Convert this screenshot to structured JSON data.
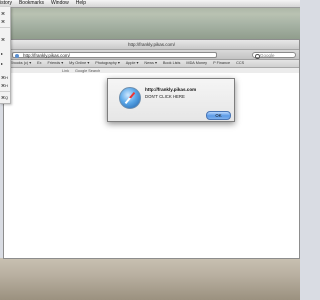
{
  "menubar": {
    "items": [
      "istory",
      "Bookmarks",
      "Window",
      "Help"
    ]
  },
  "window": {
    "title": "http://frankly.pikas.com/"
  },
  "toolbar": {
    "url": "http://frankly.pikas.com/",
    "search_placeholder": "Google"
  },
  "bookmarks_bar": {
    "items": [
      "Ebooks (c) ▾",
      "Ex",
      "Friends ▾",
      "My Online ▾",
      "Photography ▾",
      "Apple ▾",
      "News ▾",
      "Book Lists",
      "MDA Money",
      "P Finance",
      "CCS"
    ]
  },
  "page_tabs": {
    "items": [
      "Link",
      "Google Search"
    ]
  },
  "dropdown": {
    "items": [
      "⌘",
      "⌘",
      "⌘",
      "▸",
      "▸",
      "⌘H",
      "⌘H",
      "⌘Q"
    ]
  },
  "dialog": {
    "title": "http://frankly.pikas.com",
    "message": "DON'T CLICK HERE",
    "ok_label": "OK"
  }
}
